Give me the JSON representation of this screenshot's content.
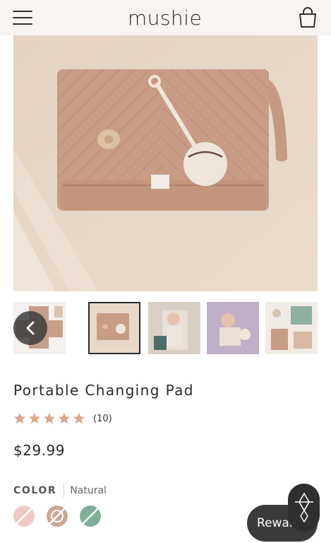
{
  "header": {
    "brand": "mushie",
    "menu_icon": "hamburger-icon",
    "cart_icon": "shopping-bag-icon"
  },
  "gallery": {
    "prev_icon": "chevron-left-icon",
    "selected_index": 1,
    "thumbnail_count": 5
  },
  "product": {
    "title": "Portable Changing Pad",
    "rating_stars": 5,
    "rating_count": "(10)",
    "price": "$29.99",
    "color_label": "COLOR",
    "color_value": "Natural",
    "swatches": [
      {
        "name": "Blush",
        "color": "#efc9c4",
        "strike": true
      },
      {
        "name": "Natural",
        "color": "#c9a791",
        "strike": true,
        "selected": true
      },
      {
        "name": "Sage",
        "color": "#7fae97",
        "strike": true
      }
    ]
  },
  "rewards": {
    "label": "Rewards"
  },
  "colors": {
    "star": "#d8a98b",
    "header_bg": "#f7f4f1",
    "pad": "#c99c85"
  }
}
